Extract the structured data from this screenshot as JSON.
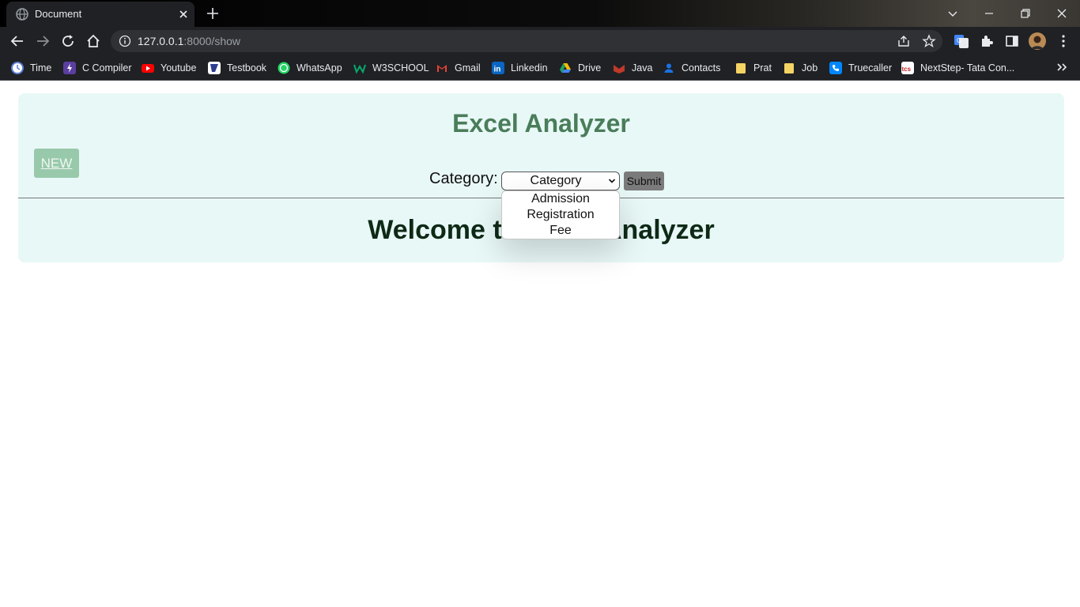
{
  "browser": {
    "tab": {
      "title": "Document"
    },
    "url": {
      "host": "127.0.0.1",
      "path": ":8000/show"
    },
    "bookmarks": [
      {
        "label": "Time",
        "icon": "clock-icon",
        "color": "#5b7fd8"
      },
      {
        "label": "C Compiler",
        "icon": "bolt-icon",
        "color": "#5a3fa0"
      },
      {
        "label": "Youtube",
        "icon": "youtube-icon",
        "color": "#ff0000"
      },
      {
        "label": "Testbook",
        "icon": "testbook-icon",
        "color": "#2d3e8f"
      },
      {
        "label": "WhatsApp",
        "icon": "whatsapp-icon",
        "color": "#25d366"
      },
      {
        "label": "W3SCHOOL",
        "icon": "w3schools-icon",
        "color": "#04aa6d"
      },
      {
        "label": "Gmail",
        "icon": "gmail-icon",
        "color": "#ea4335"
      },
      {
        "label": "Linkedin",
        "icon": "linkedin-icon",
        "color": "#0a66c2"
      },
      {
        "label": "Drive",
        "icon": "drive-icon",
        "color": "#1fa463"
      },
      {
        "label": "Java",
        "icon": "java-icon",
        "color": "#c0392b"
      },
      {
        "label": "Contacts",
        "icon": "contacts-icon",
        "color": "#1a73e8"
      },
      {
        "label": "Prat",
        "icon": "folder-icon",
        "color": "#f6d365"
      },
      {
        "label": "Job",
        "icon": "folder-icon",
        "color": "#f6d365"
      },
      {
        "label": "Truecaller",
        "icon": "truecaller-icon",
        "color": "#0087ff"
      },
      {
        "label": "NextStep- Tata Con...",
        "icon": "tcs-icon",
        "color": "#ffffff"
      }
    ]
  },
  "page": {
    "title": "Excel Analyzer",
    "new_button": "NEW",
    "category_label": "Category:",
    "category_select": {
      "value": "Category",
      "options": [
        "Admission",
        "Registration",
        "Fee"
      ]
    },
    "submit_button": "Submit",
    "welcome": "Welcome to Excel Analyzer"
  }
}
